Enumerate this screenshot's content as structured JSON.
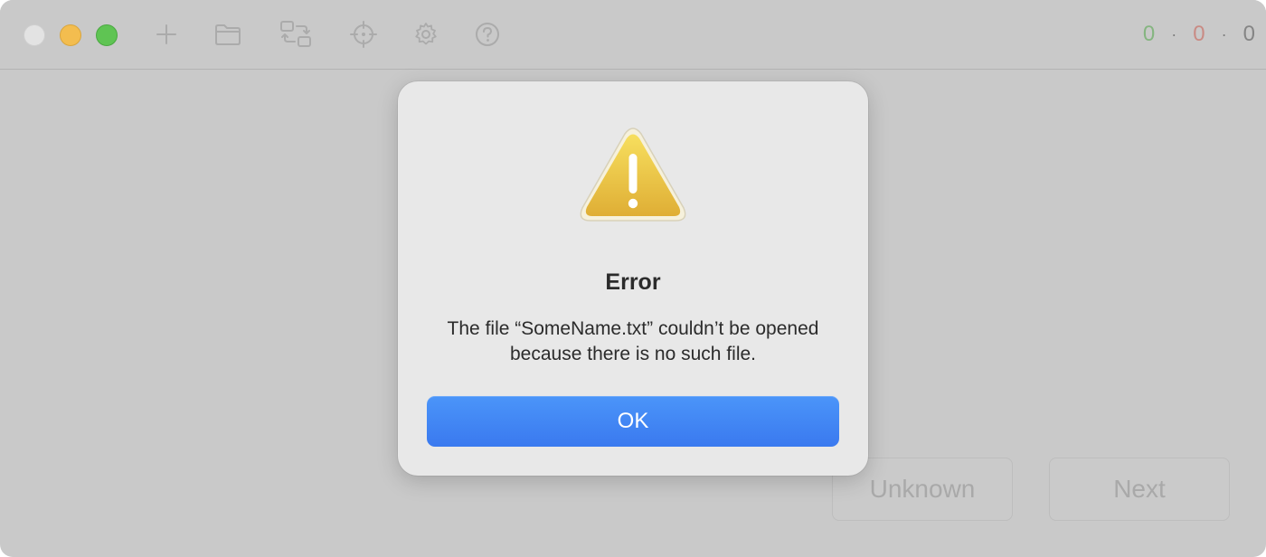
{
  "window": {
    "toolbar": {
      "icons": [
        "plus-icon",
        "folder-icon",
        "swap-icon",
        "crosshair-icon",
        "gear-icon",
        "help-icon"
      ]
    },
    "counters": {
      "correct": "0",
      "wrong": "0",
      "unknown": "0",
      "separator": "·"
    },
    "buttons": {
      "unknown_label": "Unknown",
      "next_label": "Next"
    }
  },
  "dialog": {
    "icon": "warning-icon",
    "title": "Error",
    "message": "The file “SomeName.txt” couldn’t be opened because there is no such file.",
    "ok_label": "OK"
  },
  "colors": {
    "accent": "#3a79ef",
    "correct": "#85b580",
    "wrong": "#c98b84",
    "warning": "#e6b93c"
  }
}
